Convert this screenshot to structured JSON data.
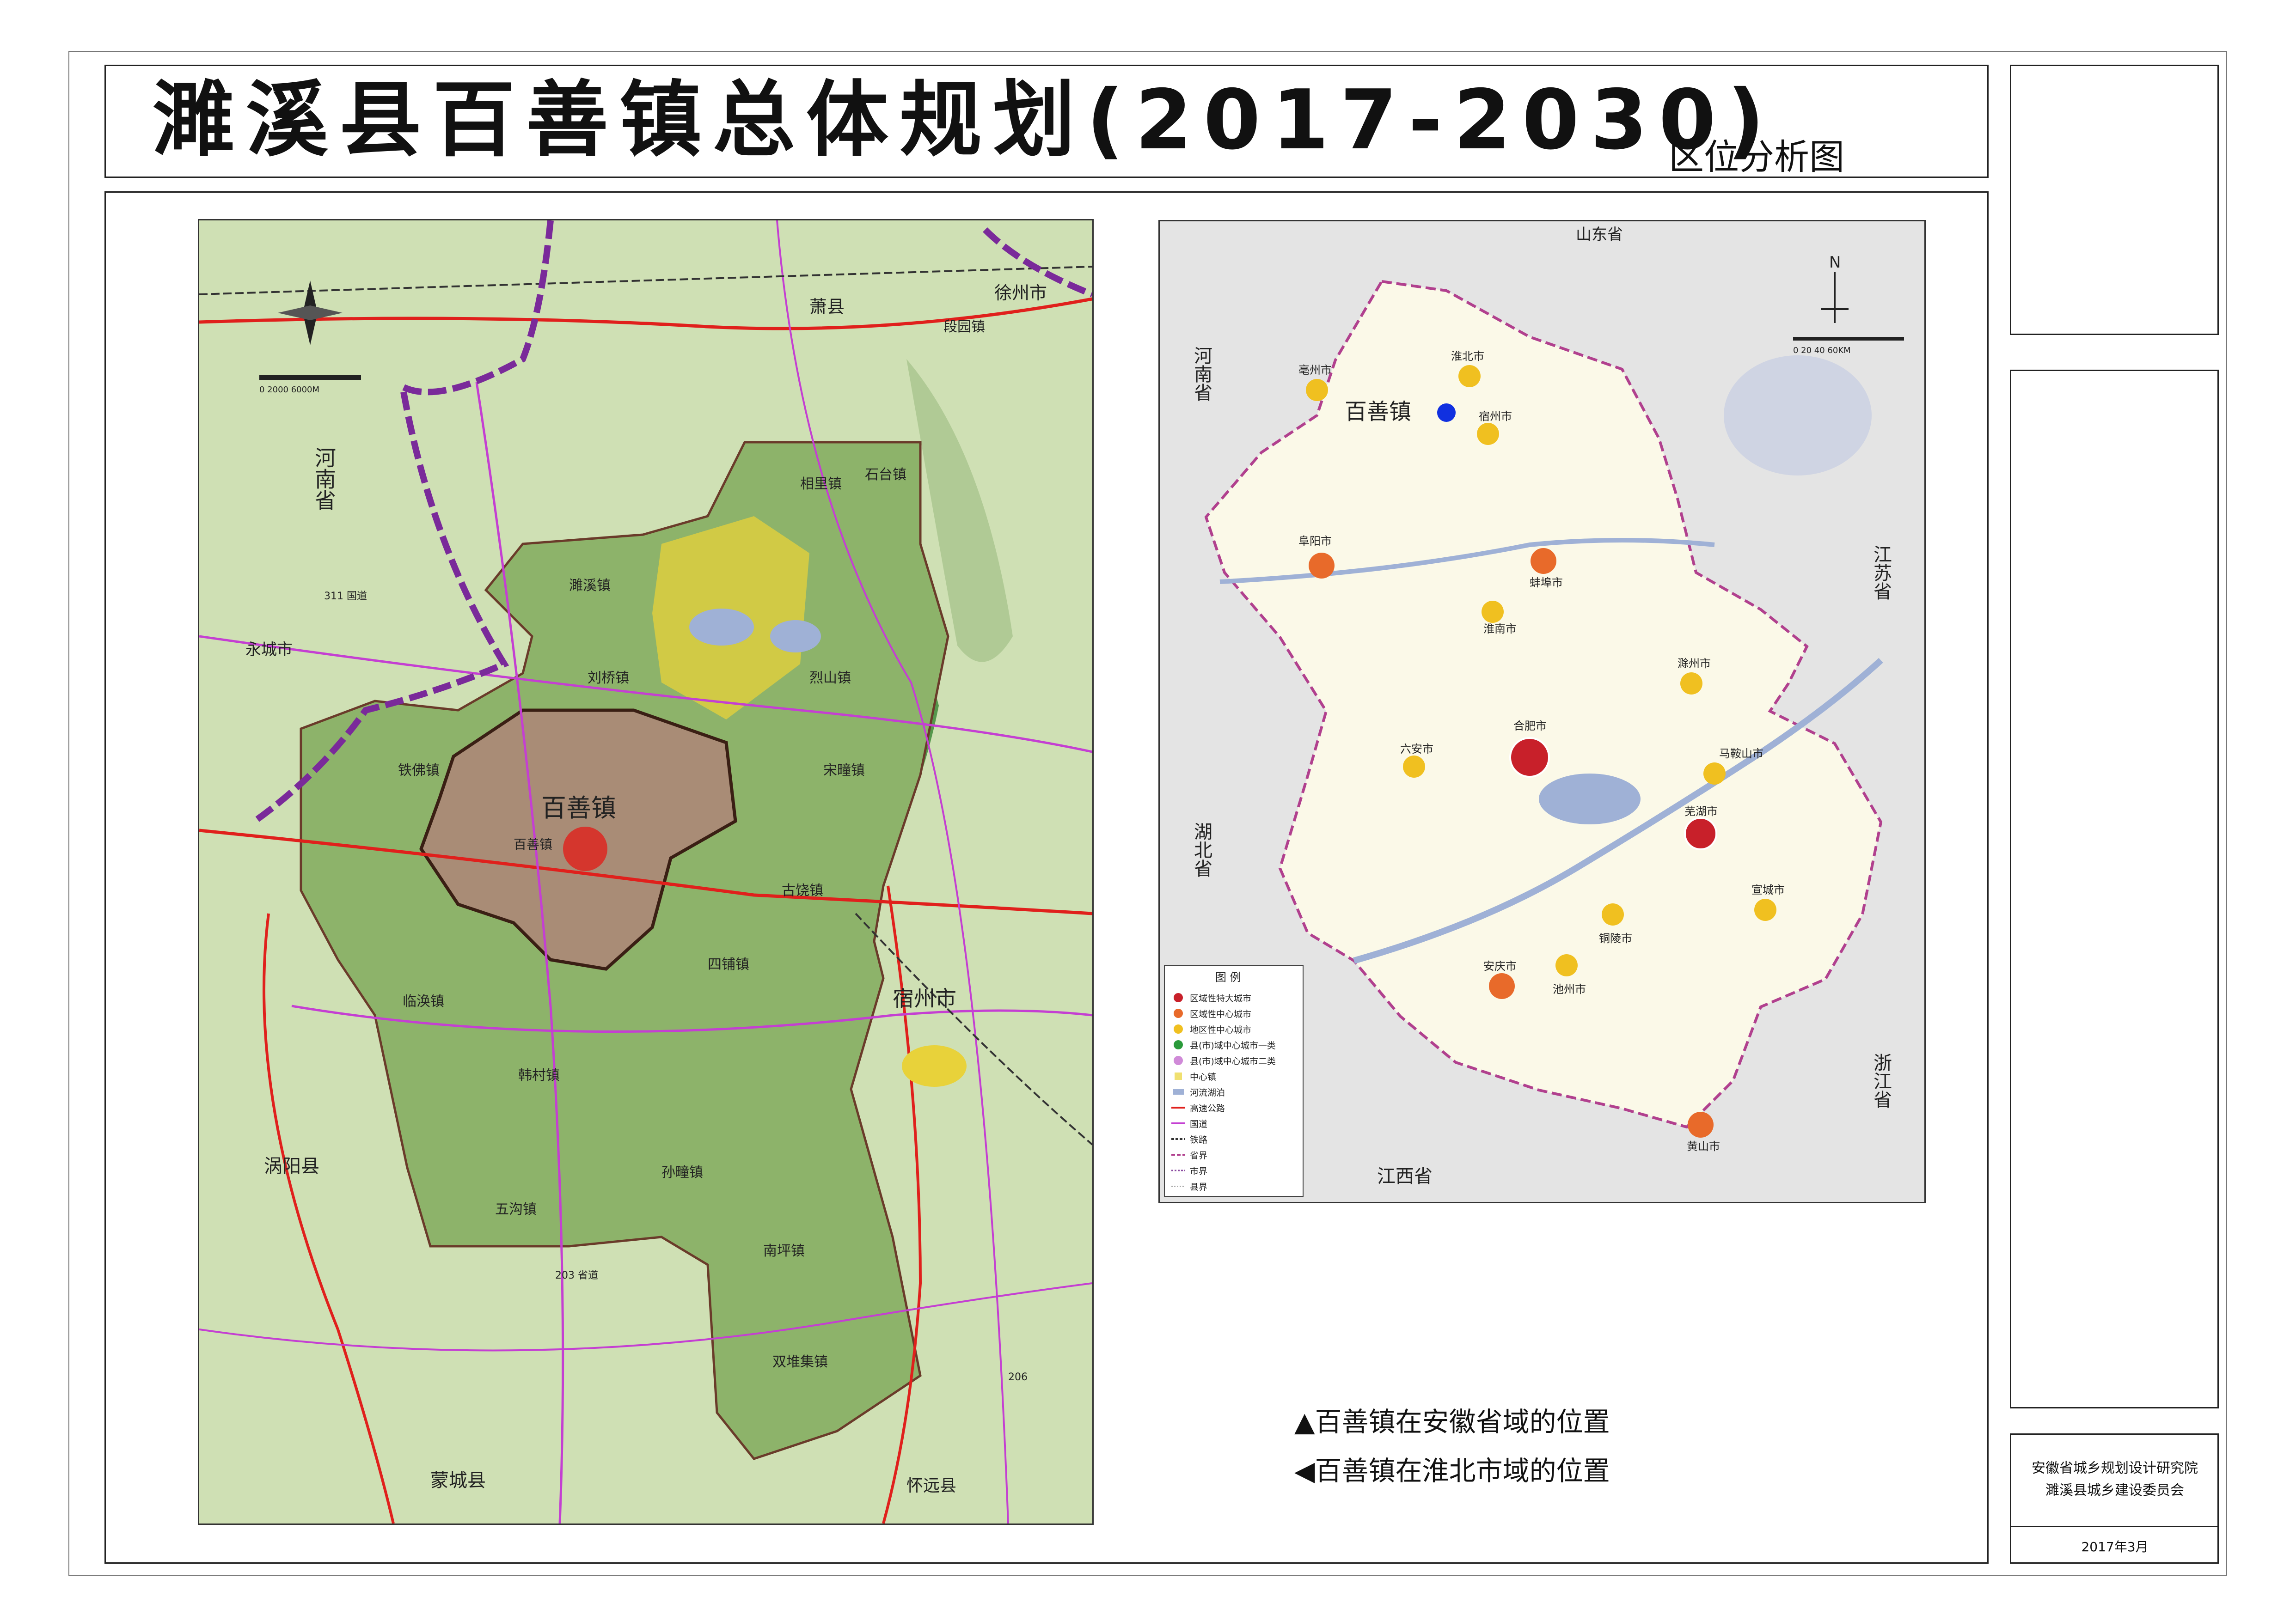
{
  "title": "濉溪县百善镇总体规划(2017-2030)",
  "subtitle": "区位分析图",
  "org_lines": [
    "安徽省城乡规划设计研究院",
    "濉溪县城乡建设委员会"
  ],
  "date": "2017年3月",
  "captions": [
    "▲百善镇在安徽省域的位置",
    "◀百善镇在淮北市域的位置"
  ],
  "left_map": {
    "highlight_label": "百善镇",
    "surrounding_labels": [
      {
        "id": "henan",
        "text": "河南省"
      },
      {
        "id": "yongcheng",
        "text": "永城市"
      },
      {
        "id": "guoyang",
        "text": "涡阳县"
      },
      {
        "id": "mengcheng",
        "text": "蒙城县"
      },
      {
        "id": "huaiyuan",
        "text": "怀远县"
      },
      {
        "id": "suzhou",
        "text": "宿州市"
      },
      {
        "id": "xiaoxian",
        "text": "萧县"
      },
      {
        "id": "xuzhou",
        "text": "徐州市"
      }
    ],
    "town_labels": [
      "百善镇",
      "铁佛镇",
      "临涣镇",
      "韩村镇",
      "五沟镇",
      "孙疃镇",
      "南坪镇",
      "双堆集镇",
      "四铺镇",
      "古饶镇",
      "宋疃镇",
      "烈山镇",
      "刘桥镇",
      "濉溪镇",
      "相里镇",
      "石台镇",
      "段园镇"
    ],
    "road_labels": [
      "203 省道",
      "206",
      "311 国道"
    ],
    "scale_text": "0 2000 6000M"
  },
  "right_map": {
    "marker_label": "百善镇",
    "neighbor_labels": [
      "山东省",
      "河南省",
      "湖北省",
      "江西省",
      "江苏省",
      "浙江省"
    ],
    "cities": [
      {
        "name": "合肥市",
        "type": "特大城市"
      },
      {
        "name": "芜湖市",
        "type": "特大城市"
      },
      {
        "name": "蚌埠市",
        "type": "区域中心"
      },
      {
        "name": "阜阳市",
        "type": "区域中心"
      },
      {
        "name": "安庆市",
        "type": "区域中心"
      },
      {
        "name": "黄山市",
        "type": "区域中心"
      },
      {
        "name": "淮北市",
        "type": "地区中心"
      },
      {
        "name": "亳州市",
        "type": "地区中心"
      },
      {
        "name": "宿州市",
        "type": "地区中心"
      },
      {
        "name": "淮南市",
        "type": "地区中心"
      },
      {
        "name": "滁州市",
        "type": "地区中心"
      },
      {
        "name": "六安市",
        "type": "地区中心"
      },
      {
        "name": "马鞍山市",
        "type": "地区中心"
      },
      {
        "name": "宣城市",
        "type": "地区中心"
      },
      {
        "name": "铜陵市",
        "type": "地区中心"
      },
      {
        "name": "池州市",
        "type": "地区中心"
      }
    ],
    "compass_label": "N",
    "scale_text": "0 20 40 60KM",
    "legend": {
      "title": "图 例",
      "items": [
        "区域性特大城市",
        "区域性中心城市",
        "地区性中心城市",
        "县(市)域中心城市一类",
        "县(市)域中心城市二类",
        "中心镇",
        "河流湖泊",
        "高速公路",
        "国道",
        "铁路",
        "省界",
        "市界",
        "县界"
      ]
    }
  },
  "colors": {
    "terrain": "#cfe0b4",
    "county": "#8db36a",
    "highlight": "#a98c76",
    "province": "#fbf9e8",
    "water": "#9fb1d6",
    "road_red": "#e0201c",
    "road_purple": "#c43fd2",
    "border_purple": "#7a2a9a"
  }
}
